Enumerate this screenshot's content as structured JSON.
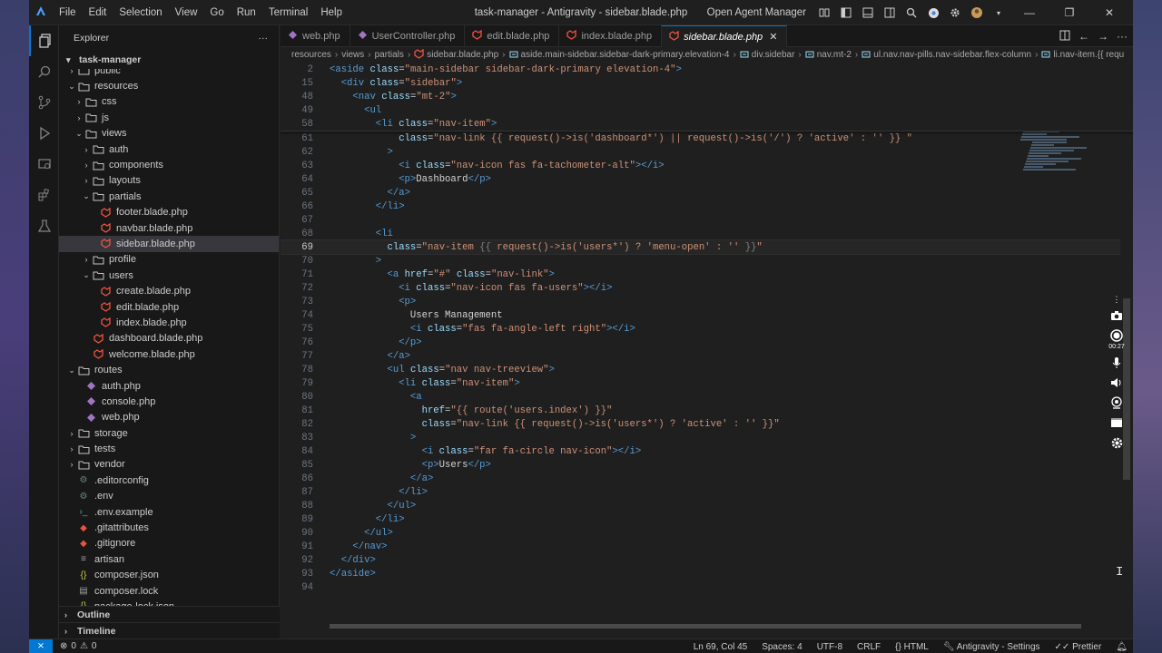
{
  "titlebar": {
    "menu": [
      "File",
      "Edit",
      "Selection",
      "View",
      "Go",
      "Run",
      "Terminal",
      "Help"
    ],
    "window_title": "task-manager - Antigravity - sidebar.blade.php",
    "open_agent_manager": "Open Agent Manager"
  },
  "sidebar": {
    "title": "Explorer",
    "more": "···",
    "project": "task-manager",
    "outline": "Outline",
    "timeline": "Timeline",
    "tree": [
      {
        "label": "public",
        "depth": 1,
        "type": "folder",
        "open": false
      },
      {
        "label": "resources",
        "depth": 1,
        "type": "folder",
        "open": true
      },
      {
        "label": "css",
        "depth": 2,
        "type": "folder",
        "open": false
      },
      {
        "label": "js",
        "depth": 2,
        "type": "folder",
        "open": false
      },
      {
        "label": "views",
        "depth": 2,
        "type": "folder",
        "open": true
      },
      {
        "label": "auth",
        "depth": 3,
        "type": "folder",
        "open": false
      },
      {
        "label": "components",
        "depth": 3,
        "type": "folder",
        "open": false
      },
      {
        "label": "layouts",
        "depth": 3,
        "type": "folder",
        "open": false
      },
      {
        "label": "partials",
        "depth": 3,
        "type": "folder",
        "open": true
      },
      {
        "label": "footer.blade.php",
        "depth": 4,
        "type": "blade"
      },
      {
        "label": "navbar.blade.php",
        "depth": 4,
        "type": "blade"
      },
      {
        "label": "sidebar.blade.php",
        "depth": 4,
        "type": "blade",
        "selected": true
      },
      {
        "label": "profile",
        "depth": 3,
        "type": "folder",
        "open": false
      },
      {
        "label": "users",
        "depth": 3,
        "type": "folder",
        "open": true
      },
      {
        "label": "create.blade.php",
        "depth": 4,
        "type": "blade"
      },
      {
        "label": "edit.blade.php",
        "depth": 4,
        "type": "blade"
      },
      {
        "label": "index.blade.php",
        "depth": 4,
        "type": "blade"
      },
      {
        "label": "dashboard.blade.php",
        "depth": 3,
        "type": "blade"
      },
      {
        "label": "welcome.blade.php",
        "depth": 3,
        "type": "blade"
      },
      {
        "label": "routes",
        "depth": 1,
        "type": "folder",
        "open": true
      },
      {
        "label": "auth.php",
        "depth": 2,
        "type": "php"
      },
      {
        "label": "console.php",
        "depth": 2,
        "type": "php"
      },
      {
        "label": "web.php",
        "depth": 2,
        "type": "php"
      },
      {
        "label": "storage",
        "depth": 1,
        "type": "folder",
        "open": false
      },
      {
        "label": "tests",
        "depth": 1,
        "type": "folder",
        "open": false
      },
      {
        "label": "vendor",
        "depth": 1,
        "type": "folder",
        "open": false
      },
      {
        "label": ".editorconfig",
        "depth": 1,
        "type": "gear"
      },
      {
        "label": ".env",
        "depth": 1,
        "type": "gear"
      },
      {
        "label": ".env.example",
        "depth": 1,
        "type": "env"
      },
      {
        "label": ".gitattributes",
        "depth": 1,
        "type": "git"
      },
      {
        "label": ".gitignore",
        "depth": 1,
        "type": "git"
      },
      {
        "label": "artisan",
        "depth": 1,
        "type": "file"
      },
      {
        "label": "composer.json",
        "depth": 1,
        "type": "json"
      },
      {
        "label": "composer.lock",
        "depth": 1,
        "type": "lock"
      },
      {
        "label": "package-lock.json",
        "depth": 1,
        "type": "json"
      }
    ]
  },
  "tabs": [
    {
      "label": "web.php",
      "icon": "php"
    },
    {
      "label": "UserController.php",
      "icon": "php"
    },
    {
      "label": "edit.blade.php",
      "icon": "blade"
    },
    {
      "label": "index.blade.php",
      "icon": "blade"
    },
    {
      "label": "sidebar.blade.php",
      "icon": "blade",
      "active": true,
      "close": "✕"
    }
  ],
  "breadcrumb": [
    {
      "label": "resources"
    },
    {
      "label": "views"
    },
    {
      "label": "partials"
    },
    {
      "label": "sidebar.blade.php",
      "icon": "blade"
    },
    {
      "label": "aside.main-sidebar.sidebar-dark-primary.elevation-4",
      "icon": "tag"
    },
    {
      "label": "div.sidebar",
      "icon": "tag"
    },
    {
      "label": "nav.mt-2",
      "icon": "tag"
    },
    {
      "label": "ul.nav.nav-pills.nav-sidebar.flex-column",
      "icon": "tag"
    },
    {
      "label": "li.nav-item.{{ requ",
      "icon": "tag"
    }
  ],
  "sticky_lines": [
    {
      "n": "2",
      "indent": 0,
      "parts": [
        [
          "tag",
          "<aside "
        ],
        [
          "attr",
          "class"
        ],
        [
          "txt",
          "="
        ],
        [
          "str",
          "\"main-sidebar sidebar-dark-primary elevation-4\""
        ],
        [
          "tag",
          ">"
        ]
      ]
    },
    {
      "n": "15",
      "indent": 2,
      "parts": [
        [
          "tag",
          "<div "
        ],
        [
          "attr",
          "class"
        ],
        [
          "txt",
          "="
        ],
        [
          "str",
          "\"sidebar\""
        ],
        [
          "tag",
          ">"
        ]
      ]
    },
    {
      "n": "48",
      "indent": 4,
      "parts": [
        [
          "tag",
          "<nav "
        ],
        [
          "attr",
          "class"
        ],
        [
          "txt",
          "="
        ],
        [
          "str",
          "\"mt-2\""
        ],
        [
          "tag",
          ">"
        ]
      ]
    },
    {
      "n": "49",
      "indent": 6,
      "parts": [
        [
          "tag",
          "<ul"
        ]
      ]
    },
    {
      "n": "58",
      "indent": 8,
      "parts": [
        [
          "tag",
          "<li "
        ],
        [
          "attr",
          "class"
        ],
        [
          "txt",
          "="
        ],
        [
          "str",
          "\"nav-item\""
        ],
        [
          "tag",
          ">"
        ]
      ]
    }
  ],
  "code_lines": [
    {
      "n": "61",
      "indent": 12,
      "parts": [
        [
          "attr",
          "class"
        ],
        [
          "txt",
          "="
        ],
        [
          "str",
          "\"nav-link {{ request()->is('dashboard*') || request()->is('/') ? 'active' : '' }} \""
        ]
      ]
    },
    {
      "n": "62",
      "indent": 10,
      "parts": [
        [
          "tag",
          ">"
        ]
      ]
    },
    {
      "n": "63",
      "indent": 12,
      "parts": [
        [
          "tag",
          "<i "
        ],
        [
          "attr",
          "class"
        ],
        [
          "txt",
          "="
        ],
        [
          "str",
          "\"nav-icon fas fa-tachometer-alt\""
        ],
        [
          "tag",
          "></i>"
        ]
      ]
    },
    {
      "n": "64",
      "indent": 12,
      "parts": [
        [
          "tag",
          "<p>"
        ],
        [
          "txt",
          "Dashboard"
        ],
        [
          "tag",
          "</p>"
        ]
      ]
    },
    {
      "n": "65",
      "indent": 10,
      "parts": [
        [
          "tag",
          "</a>"
        ]
      ]
    },
    {
      "n": "66",
      "indent": 8,
      "parts": [
        [
          "tag",
          "</li>"
        ]
      ]
    },
    {
      "n": "67",
      "indent": 0,
      "parts": []
    },
    {
      "n": "68",
      "indent": 8,
      "parts": [
        [
          "tag",
          "<li"
        ]
      ]
    },
    {
      "n": "69",
      "indent": 10,
      "current": true,
      "parts": [
        [
          "attr",
          "class"
        ],
        [
          "txt",
          "="
        ],
        [
          "str",
          "\"nav-item "
        ],
        [
          "brk",
          "{{"
        ],
        [
          "str",
          " request()->is('users*') ? 'menu-open' : '' "
        ],
        [
          "brk",
          "}}"
        ],
        [
          "str",
          "\""
        ]
      ]
    },
    {
      "n": "70",
      "indent": 8,
      "parts": [
        [
          "tag",
          ">"
        ]
      ]
    },
    {
      "n": "71",
      "indent": 10,
      "parts": [
        [
          "tag",
          "<a "
        ],
        [
          "attr",
          "href"
        ],
        [
          "txt",
          "="
        ],
        [
          "str",
          "\"#\" "
        ],
        [
          "attr",
          "class"
        ],
        [
          "txt",
          "="
        ],
        [
          "str",
          "\"nav-link\""
        ],
        [
          "tag",
          ">"
        ]
      ]
    },
    {
      "n": "72",
      "indent": 12,
      "parts": [
        [
          "tag",
          "<i "
        ],
        [
          "attr",
          "class"
        ],
        [
          "txt",
          "="
        ],
        [
          "str",
          "\"nav-icon fas fa-users\""
        ],
        [
          "tag",
          "></i>"
        ]
      ]
    },
    {
      "n": "73",
      "indent": 12,
      "parts": [
        [
          "tag",
          "<p>"
        ]
      ]
    },
    {
      "n": "74",
      "indent": 14,
      "parts": [
        [
          "txt",
          "Users Management"
        ]
      ]
    },
    {
      "n": "75",
      "indent": 14,
      "parts": [
        [
          "tag",
          "<i "
        ],
        [
          "attr",
          "class"
        ],
        [
          "txt",
          "="
        ],
        [
          "str",
          "\"fas fa-angle-left right\""
        ],
        [
          "tag",
          "></i>"
        ]
      ]
    },
    {
      "n": "76",
      "indent": 12,
      "parts": [
        [
          "tag",
          "</p>"
        ]
      ]
    },
    {
      "n": "77",
      "indent": 10,
      "parts": [
        [
          "tag",
          "</a>"
        ]
      ]
    },
    {
      "n": "78",
      "indent": 10,
      "parts": [
        [
          "tag",
          "<ul "
        ],
        [
          "attr",
          "class"
        ],
        [
          "txt",
          "="
        ],
        [
          "str",
          "\"nav nav-treeview\""
        ],
        [
          "tag",
          ">"
        ]
      ]
    },
    {
      "n": "79",
      "indent": 12,
      "parts": [
        [
          "tag",
          "<li "
        ],
        [
          "attr",
          "class"
        ],
        [
          "txt",
          "="
        ],
        [
          "str",
          "\"nav-item\""
        ],
        [
          "tag",
          ">"
        ]
      ]
    },
    {
      "n": "80",
      "indent": 14,
      "parts": [
        [
          "tag",
          "<a"
        ]
      ]
    },
    {
      "n": "81",
      "indent": 16,
      "parts": [
        [
          "attr",
          "href"
        ],
        [
          "txt",
          "="
        ],
        [
          "str",
          "\"{{ route('users.index') }}\""
        ]
      ]
    },
    {
      "n": "82",
      "indent": 16,
      "parts": [
        [
          "attr",
          "class"
        ],
        [
          "txt",
          "="
        ],
        [
          "str",
          "\"nav-link {{ request()->is('users*') ? 'active' : '' }}\""
        ]
      ]
    },
    {
      "n": "83",
      "indent": 14,
      "parts": [
        [
          "tag",
          ">"
        ]
      ]
    },
    {
      "n": "84",
      "indent": 16,
      "parts": [
        [
          "tag",
          "<i "
        ],
        [
          "attr",
          "class"
        ],
        [
          "txt",
          "="
        ],
        [
          "str",
          "\"far fa-circle nav-icon\""
        ],
        [
          "tag",
          "></i>"
        ]
      ]
    },
    {
      "n": "85",
      "indent": 16,
      "parts": [
        [
          "tag",
          "<p>"
        ],
        [
          "txt",
          "Users"
        ],
        [
          "tag",
          "</p>"
        ]
      ]
    },
    {
      "n": "86",
      "indent": 14,
      "parts": [
        [
          "tag",
          "</a>"
        ]
      ]
    },
    {
      "n": "87",
      "indent": 12,
      "parts": [
        [
          "tag",
          "</li>"
        ]
      ]
    },
    {
      "n": "88",
      "indent": 10,
      "parts": [
        [
          "tag",
          "</ul>"
        ]
      ]
    },
    {
      "n": "89",
      "indent": 8,
      "parts": [
        [
          "tag",
          "</li>"
        ]
      ]
    },
    {
      "n": "90",
      "indent": 6,
      "parts": [
        [
          "tag",
          "</ul>"
        ]
      ]
    },
    {
      "n": "91",
      "indent": 4,
      "parts": [
        [
          "tag",
          "</nav>"
        ]
      ]
    },
    {
      "n": "92",
      "indent": 2,
      "parts": [
        [
          "tag",
          "</div>"
        ]
      ]
    },
    {
      "n": "93",
      "indent": 0,
      "parts": [
        [
          "tag",
          "</aside>"
        ]
      ]
    },
    {
      "n": "94",
      "indent": 0,
      "parts": []
    }
  ],
  "statusbar": {
    "errors": "0",
    "warnings": "0",
    "position": "Ln 69, Col 45",
    "spaces": "Spaces: 4",
    "encoding": "UTF-8",
    "eol": "CRLF",
    "language": "HTML",
    "settings": "Antigravity - Settings",
    "formatter": "Prettier"
  },
  "recorder": {
    "time": "00:27"
  },
  "colors": {
    "accent": "#0078d4",
    "blade_icon": "#f05340",
    "php_icon": "#a074c4"
  }
}
